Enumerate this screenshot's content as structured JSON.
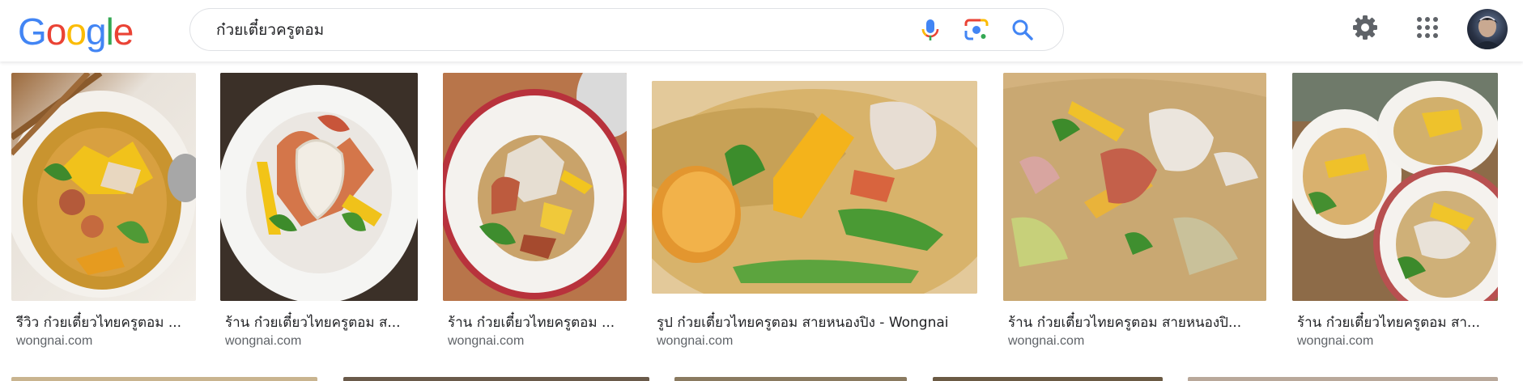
{
  "search": {
    "query": "ก๋วยเตี๋ยวครูตอม"
  },
  "logo": {
    "letters": [
      "G",
      "o",
      "o",
      "g",
      "l",
      "e"
    ],
    "colors": [
      "#4285F4",
      "#EA4335",
      "#FBBC05",
      "#4285F4",
      "#34A853",
      "#EA4335"
    ]
  },
  "colors": {
    "caption": "#202124",
    "domain": "#5f6368",
    "search_border": "#dfe1e5",
    "icon_gray": "#5f6368",
    "mic_blue": "#4285F4",
    "mic_red": "#EA4335",
    "mic_yellow": "#FBBC05",
    "mic_green": "#34A853"
  },
  "icons": {
    "mic": "mic-icon",
    "lens": "camera-lens-icon",
    "search": "search-icon",
    "settings": "gear-icon",
    "apps": "apps-grid-icon"
  },
  "results": [
    {
      "caption": "รีวิว ก๋วยเตี๋ยวไทยครูตอม ...",
      "domain": "wongnai.com"
    },
    {
      "caption": "ร้าน ก๋วยเตี๋ยวไทยครูตอม ส...",
      "domain": "wongnai.com"
    },
    {
      "caption": "ร้าน ก๋วยเตี๋ยวไทยครูตอม ...",
      "domain": "wongnai.com"
    },
    {
      "caption": "รูป ก๋วยเตี๋ยวไทยครูตอม สายหนองปิง - Wongnai",
      "domain": "wongnai.com"
    },
    {
      "caption": "ร้าน ก๋วยเตี๋ยวไทยครูตอม สายหนองปิ...",
      "domain": "wongnai.com"
    },
    {
      "caption": "ร้าน ก๋วยเตี๋ยวไทยครูตอม สา...",
      "domain": "wongnai.com"
    }
  ]
}
